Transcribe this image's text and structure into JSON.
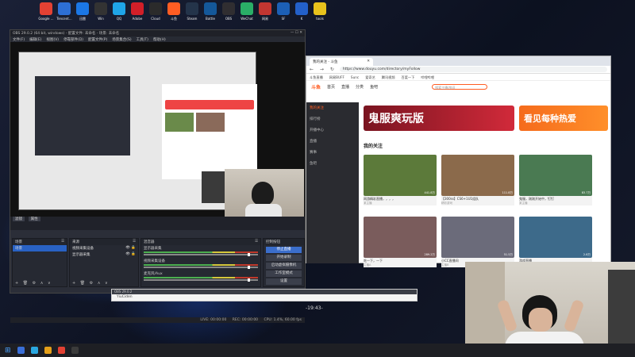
{
  "desktop_icons": [
    {
      "label": "Google ...",
      "color": "#e34133"
    },
    {
      "label": "Tencent...",
      "color": "#2d6fd6"
    },
    {
      "label": "迅雷",
      "color": "#1b77e6"
    },
    {
      "label": "Win",
      "color": "#333333"
    },
    {
      "label": "QQ",
      "color": "#1fa5e8"
    },
    {
      "label": "Adobe",
      "color": "#d21f28"
    },
    {
      "label": "Cloud",
      "color": "#2b2b2b"
    },
    {
      "label": "斗鱼",
      "color": "#ff5d23"
    },
    {
      "label": "Steam",
      "color": "#24344a"
    },
    {
      "label": "Battle",
      "color": "#14589a"
    },
    {
      "label": "OBS",
      "color": "#302e31"
    },
    {
      "label": "WeChat",
      "color": "#2aae67"
    },
    {
      "label": "网易",
      "color": "#c23631"
    },
    {
      "label": "SF",
      "color": "#1c5fb5"
    },
    {
      "label": "K",
      "color": "#2360c9"
    },
    {
      "label": "tools",
      "color": "#e8c21c"
    }
  ],
  "obs": {
    "title": "OBS 29.0.2 (64 bit, windows) - 配置文件: 未命名 - 场景: 未命名",
    "menu": [
      "文件(F)",
      "编辑(E)",
      "视图(V)",
      "停靠部件(D)",
      "配置文件(P)",
      "场景集合(S)",
      "工具(T)",
      "帮助(H)"
    ],
    "scenes_panel": {
      "title": "场景",
      "items": [
        "场景"
      ]
    },
    "sources_panel": {
      "title": "来源",
      "items": [
        "视频采集设备",
        "显示器采集"
      ]
    },
    "mixer_panel": {
      "title": "混音器",
      "items": [
        "显示器采集",
        "视频采集设备",
        "麦克风/Aux"
      ]
    },
    "controls_panel": {
      "title": "控制按钮",
      "items": [
        "停止直播",
        "开始录制",
        "启动虚拟摄像机",
        "工作室模式",
        "设置",
        "退出"
      ]
    },
    "dock_labels": {
      "scene_filter": "滤镜",
      "source_props": "属性"
    },
    "control_buttons_bottom": [
      "控制按钮",
      "转场特效"
    ],
    "status": {
      "live": "LIVE: 00:00:00",
      "rec": "REC: 00:00:00",
      "cpu": "CPU: 1.4%, 60.00 fps"
    }
  },
  "browser": {
    "tab_title": "我的关注 - 斗鱼",
    "url": "https://www.douyu.com/directory/myFollow",
    "bookmarks": [
      "斗鱼直播",
      "网易BUFF",
      "Sunc",
      "爱奇艺",
      "腾讯视频",
      "百度一下",
      "哔哩哔哩"
    ],
    "nav": [
      "首页",
      "直播",
      "分类",
      "鱼吧"
    ],
    "search_placeholder": "搜索主播/房间",
    "sidebar": [
      "我的关注",
      "排行榜",
      "开播中心",
      "直播",
      "赛事",
      "鱼吧"
    ],
    "banner_left": "鬼服爽玩版",
    "banner_right": "看见每种热爱",
    "section_title": "我的关注",
    "live_cards": [
      {
        "title": "网游精彩直播，，，，",
        "user": "某主播",
        "count": "441.8万"
      },
      {
        "title": "【300ss】CS6+1U1组队",
        "user": "精彩游戏",
        "count": "111.8万"
      },
      {
        "title": "鬼服，刚刚开始中，钉钉",
        "user": "某主播",
        "count": "83.7万"
      },
      {
        "title": "吃一下，一下",
        "user": "主播A",
        "count": "289.2万"
      },
      {
        "title": "小CC直播间",
        "user": "主播B",
        "count": "51.5万"
      },
      {
        "title": "游戏直播",
        "user": "主播C",
        "count": "2.8万"
      }
    ]
  },
  "clock": "-19:43-",
  "mini_window": {
    "bar": "OBS 29.0.2",
    "text": "YiuCiden"
  }
}
